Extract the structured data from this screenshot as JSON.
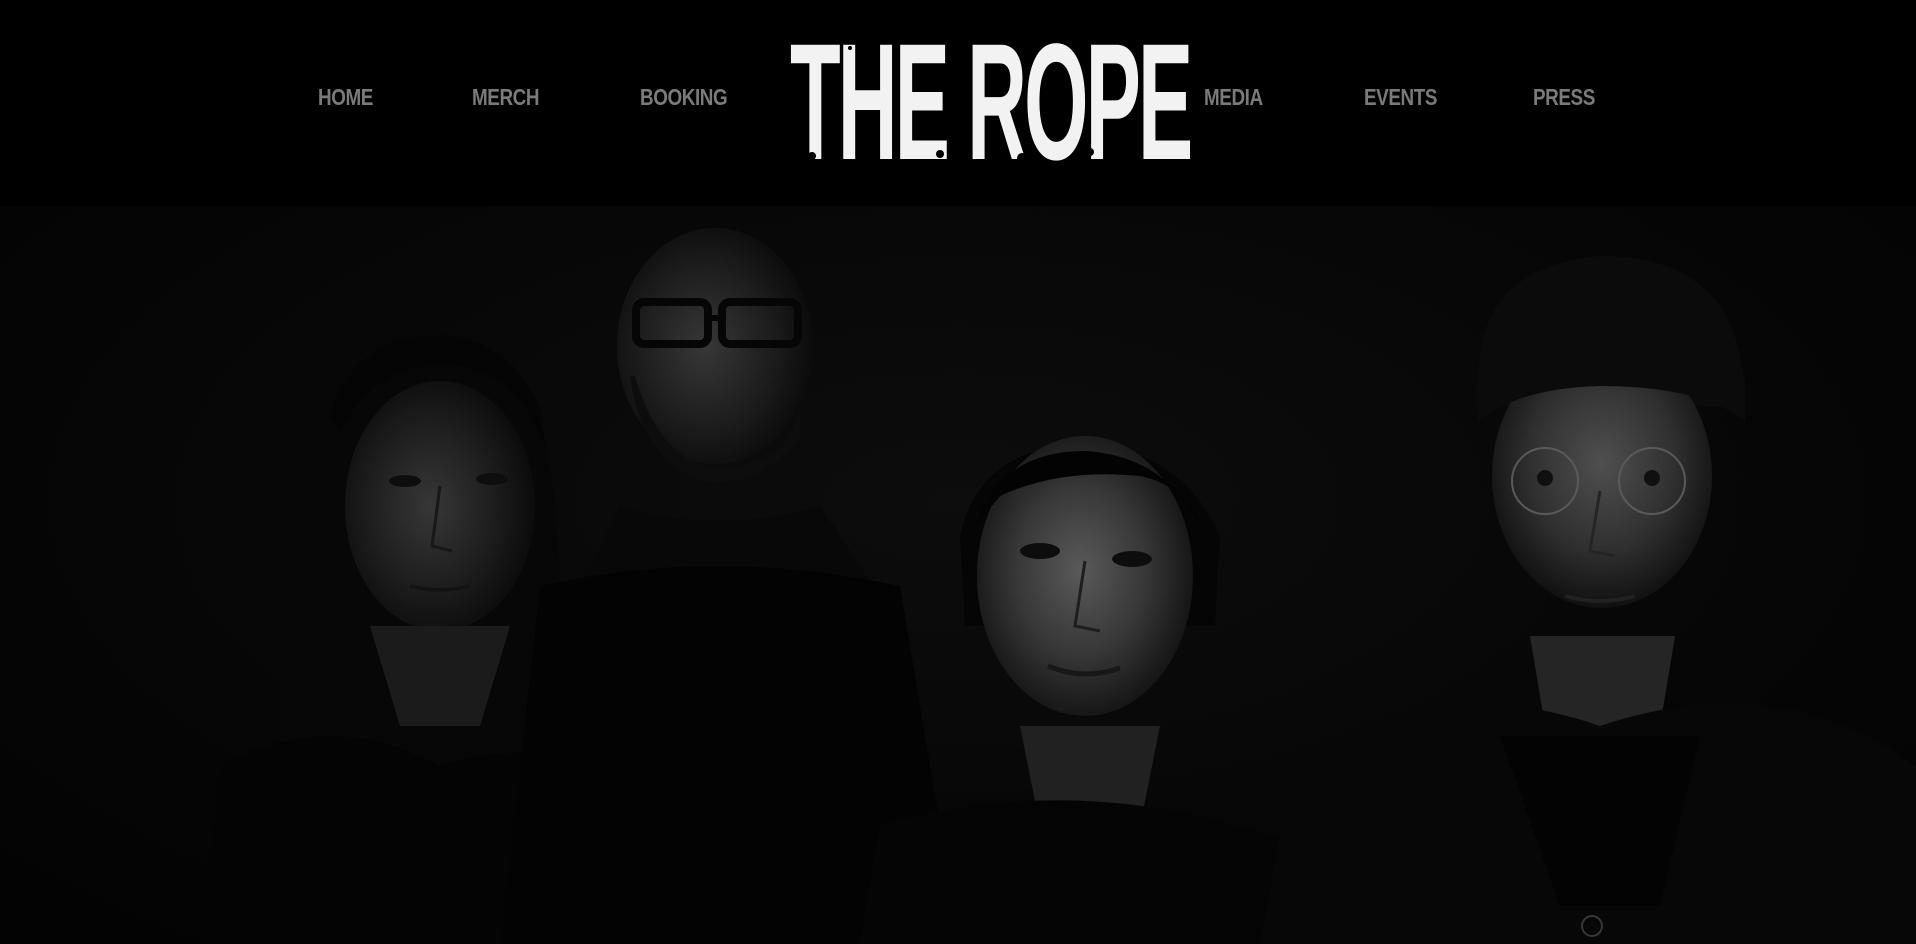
{
  "nav": {
    "left": [
      {
        "label": "HOME"
      },
      {
        "label": "MERCH"
      },
      {
        "label": "BOOKING"
      }
    ],
    "right": [
      {
        "label": "MEDIA"
      },
      {
        "label": "EVENTS"
      },
      {
        "label": "PRESS"
      }
    ]
  },
  "logo": {
    "text": "THE ROPE"
  },
  "hero": {
    "image": "band-photo"
  },
  "colors": {
    "background": "#000000",
    "nav_text": "#7a7a7a",
    "logo": "#f2f2f2"
  }
}
